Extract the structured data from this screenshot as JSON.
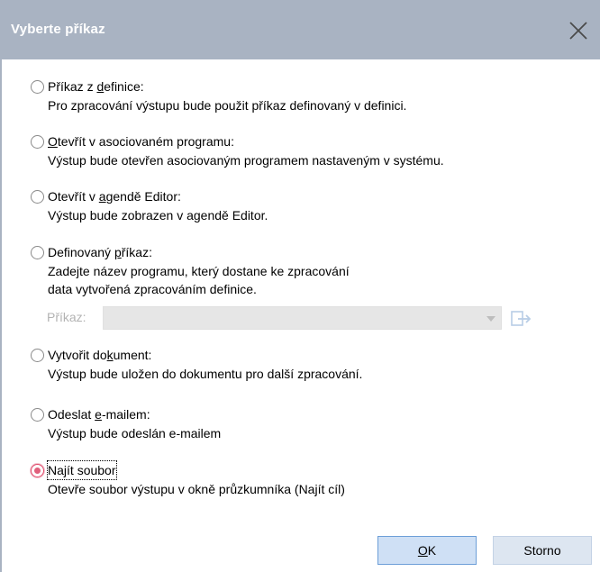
{
  "window": {
    "title": "Vyberte příkaz",
    "close_icon": "close-icon"
  },
  "options": [
    {
      "label_pre": "Příkaz z ",
      "label_u": "d",
      "label_post": "efinice:",
      "description": "Pro zpracování výstupu bude použit příkaz definovaný v definici.",
      "checked": false
    },
    {
      "label_pre": "",
      "label_u": "O",
      "label_post": "tevřít v asociovaném programu:",
      "description": "Výstup bude otevřen asociovaným programem nastaveným v systému.",
      "checked": false
    },
    {
      "label_pre": "Otevřít v ",
      "label_u": "a",
      "label_post": "gendě Editor:",
      "description": "Výstup bude zobrazen v agendě Editor.",
      "checked": false
    },
    {
      "label_pre": "Definovaný ",
      "label_u": "p",
      "label_post": "říkaz:",
      "description_lines": [
        "Zadejte název programu, který dostane ke zpracování",
        "data vytvořená zpracováním definice."
      ],
      "checked": false
    },
    {
      "label_pre": "Vytvořit do",
      "label_u": "k",
      "label_post": "ument:",
      "description": "Výstup bude uložen do dokumentu pro další zpracování.",
      "checked": false
    },
    {
      "label_pre": "Odeslat ",
      "label_u": "e",
      "label_post": "-mailem:",
      "description": "Výstup bude odeslán e-mailem",
      "checked": false
    },
    {
      "label_pre": "Na",
      "label_u": "j",
      "label_post": "ít soubor",
      "description": "Otevře soubor výstupu v okně průzkumníka (Najít cíl)",
      "checked": true
    }
  ],
  "command": {
    "label": "Příkaz:",
    "value": "",
    "browse_icon": "browse-icon"
  },
  "buttons": {
    "ok_u": "O",
    "ok_rest": "K",
    "cancel": "Storno"
  },
  "colors": {
    "titlebar": "#a9b3c2",
    "radio_checked": "#e0607c",
    "button_primary": "#cfe0f5"
  }
}
